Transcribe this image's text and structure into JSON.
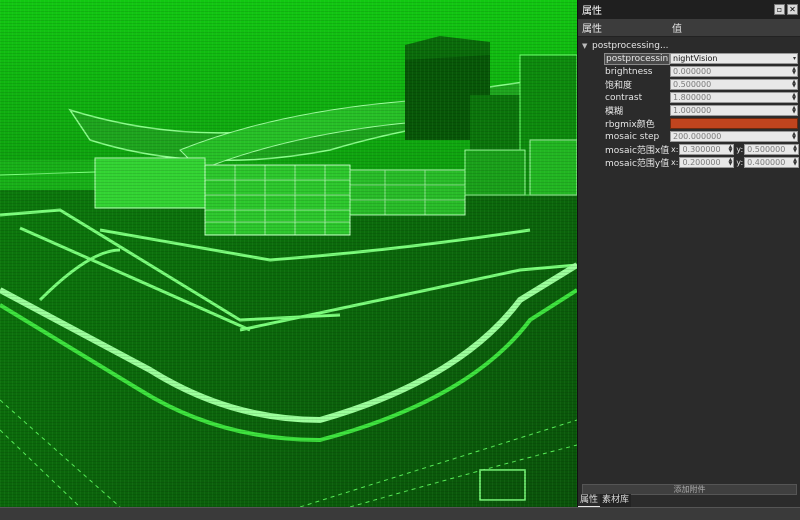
{
  "panel": {
    "title": "属性",
    "columns": {
      "name": "属性",
      "value": "值"
    },
    "group_label": "postprocessing...",
    "rows": {
      "effect": {
        "label": "postprocessin...",
        "value": "nightVision"
      },
      "brightness": {
        "label": "brightness",
        "value": "0.000000"
      },
      "saturation": {
        "label": "饱和度",
        "value": "0.500000"
      },
      "contrast": {
        "label": "contrast",
        "value": "1.800000"
      },
      "blur": {
        "label": "模糊",
        "value": "1.000000"
      },
      "rgbmix": {
        "label": "rbgmix颜色",
        "color": "#c0441e"
      },
      "mosaic_step": {
        "label": "mosaic step",
        "value": "200.000000"
      },
      "mosaic_x": {
        "label": "mosaic范围x值",
        "x_label": "x:",
        "x": "0.300000",
        "y_label": "y:",
        "y": "0.500000"
      },
      "mosaic_y": {
        "label": "mosaic范围y值",
        "x_label": "x:",
        "x": "0.200000",
        "y_label": "y:",
        "y": "0.400000"
      }
    },
    "add_component": "添加附件",
    "tabs": {
      "properties": "属性",
      "materials": "素材库"
    }
  },
  "window_buttons": {
    "float": "▫",
    "close": "✕"
  },
  "icons": {
    "expand": "expand-arrow-icon",
    "spin": "spin-arrows-icon",
    "dropdown": "dropdown-arrow-icon"
  },
  "colors": {
    "viewport_tint": "#0d5f0d",
    "panel_bg": "#2b2b2b",
    "accent_swatch": "#c0441e"
  }
}
